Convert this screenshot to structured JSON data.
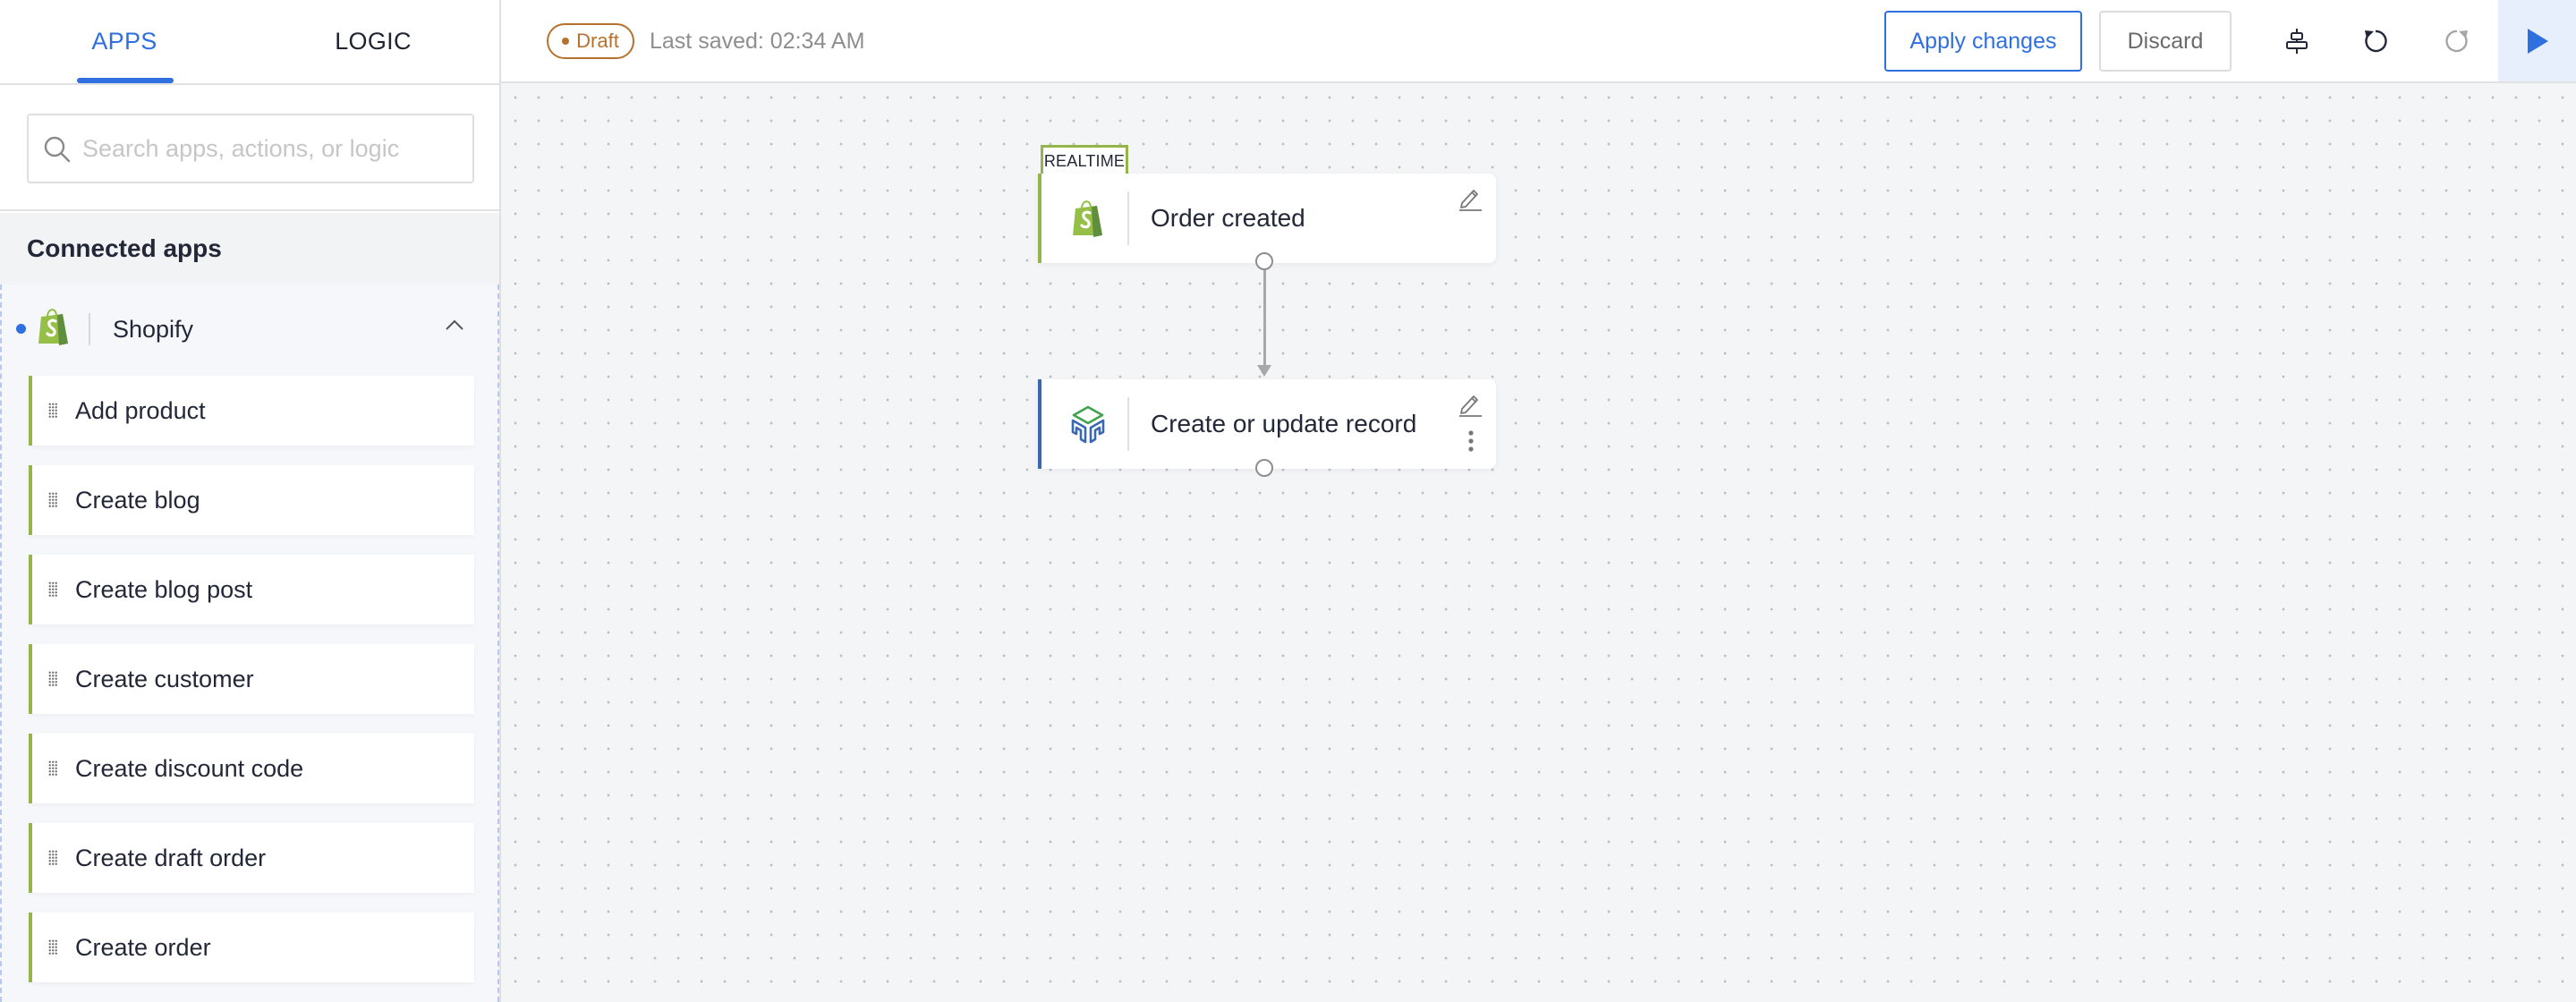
{
  "sidebar": {
    "tabs": [
      {
        "label": "APPS",
        "active": true
      },
      {
        "label": "LOGIC",
        "active": false
      }
    ],
    "search": {
      "placeholder": "Search apps, actions, or logic",
      "value": ""
    },
    "section_title": "Connected apps",
    "app": {
      "name": "Shopify",
      "logo": "shopify-bag-icon",
      "expanded": true,
      "status_dot_color": "#2f6fe0",
      "actions": [
        {
          "label": "Add product"
        },
        {
          "label": "Create blog"
        },
        {
          "label": "Create blog post"
        },
        {
          "label": "Create customer"
        },
        {
          "label": "Create discount code"
        },
        {
          "label": "Create draft order"
        },
        {
          "label": "Create order"
        }
      ]
    }
  },
  "header": {
    "status_badge": "Draft",
    "last_saved": "Last saved: 02:34 AM",
    "apply_label": "Apply changes",
    "discard_label": "Discard",
    "icons": [
      "align-center-icon",
      "undo-icon",
      "redo-icon",
      "play-icon"
    ]
  },
  "canvas": {
    "nodes": [
      {
        "type": "trigger",
        "badge": "REALTIME",
        "title": "Order created",
        "app_icon": "shopify-bag-icon",
        "accent": "#95b54a"
      },
      {
        "type": "action",
        "title": "Create or update record",
        "app_icon": "record-cube-icon",
        "accent": "#3a68b0"
      }
    ],
    "connections": [
      {
        "from": 0,
        "to": 1
      }
    ]
  },
  "colors": {
    "accent_blue": "#2f6fe0",
    "shopify_green": "#95b54a",
    "draft_brown": "#b5722e",
    "canvas_bg": "#f4f5f7"
  }
}
